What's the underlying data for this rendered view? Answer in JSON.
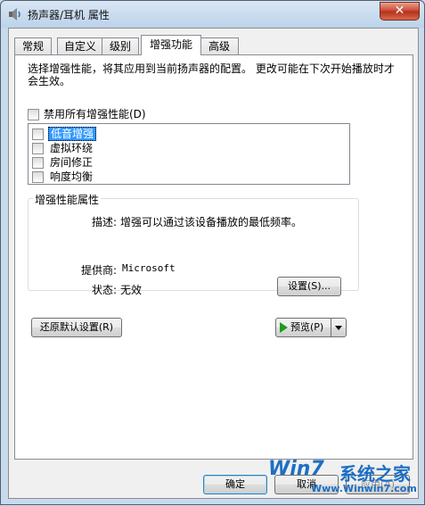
{
  "window": {
    "title": "扬声器/耳机 属性",
    "close_label": "✕"
  },
  "tabs": [
    {
      "label": "常规"
    },
    {
      "label": "自定义"
    },
    {
      "label": "级别"
    },
    {
      "label": "增强功能"
    },
    {
      "label": "高级"
    }
  ],
  "active_tab": "增强功能",
  "description": "选择增强性能，将其应用到当前扬声器的配置。  更改可能在下次开始播放时才会生效。",
  "disable_all_label": "禁用所有增强性能(D)",
  "enhancements": [
    {
      "label": "低音增强",
      "checked": false,
      "selected": true
    },
    {
      "label": "虚拟环绕",
      "checked": false,
      "selected": false
    },
    {
      "label": "房间修正",
      "checked": false,
      "selected": false
    },
    {
      "label": "响度均衡",
      "checked": false,
      "selected": false
    }
  ],
  "properties": {
    "group_title": "增强性能属性",
    "description_key": "描述:",
    "description_value": "增强可以通过该设备播放的最低频率。",
    "provider_key": "提供商:",
    "provider_value": "Microsoft",
    "status_key": "状态:",
    "status_value": "无效",
    "settings_button": "设置(S)..."
  },
  "restore_button": "还原默认设置(R)",
  "preview_button": "预览(P)",
  "footer": {
    "ok_label": "确定",
    "cancel_label": "取消",
    "apply_label": "应用(A)"
  },
  "watermark": {
    "logo": "Win7",
    "brand": "系统之家",
    "url": "Www.Winwin7.com"
  },
  "colors": {
    "selection": "#3399ff",
    "close_button": "#c9452f",
    "watermark": "#1d6fc4"
  }
}
